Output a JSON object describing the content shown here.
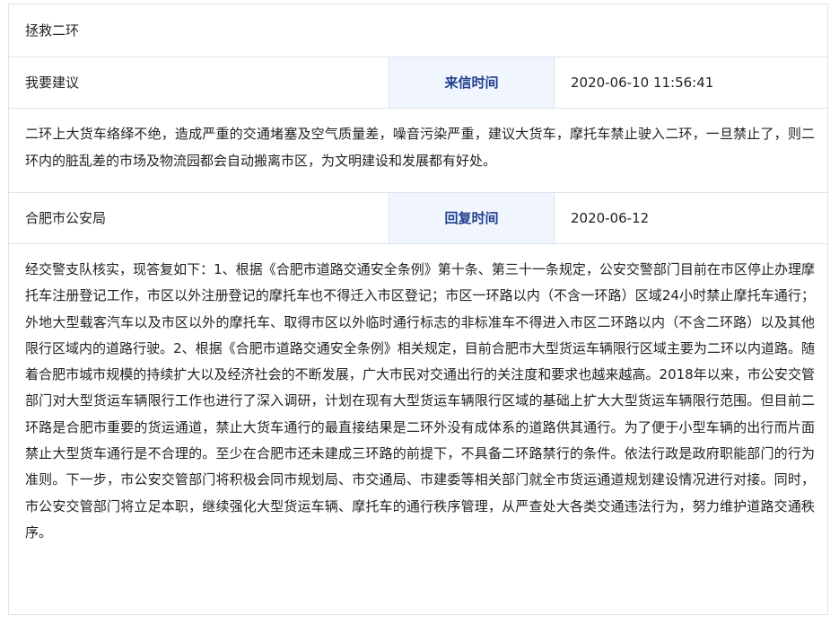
{
  "petition": {
    "title": "拯救二环",
    "type_label": "我要建议",
    "sent_time_label": "来信时间",
    "sent_time": "2020-06-10 11:56:41",
    "content": "二环上大货车络绎不绝，造成严重的交通堵塞及空气质量差，噪音污染严重，建议大货车，摩托车禁止驶入二环，一旦禁止了，则二环内的脏乱差的市场及物流园都会自动搬离市区，为文明建设和发展都有好处。"
  },
  "reply": {
    "department": "合肥市公安局",
    "reply_time_label": "回复时间",
    "reply_time": "2020-06-12",
    "content": "经交警支队核实，现答复如下：1、根据《合肥市道路交通安全条例》第十条、第三十一条规定，公安交警部门目前在市区停止办理摩托车注册登记工作，市区以外注册登记的摩托车也不得迁入市区登记；市区一环路以内（不含一环路）区域24小时禁止摩托车通行；外地大型载客汽车以及市区以外的摩托车、取得市区以外临时通行标志的非标准车不得进入市区二环路以内（不含二环路）以及其他限行区域内的道路行驶。2、根据《合肥市道路交通安全条例》相关规定，目前合肥市大型货运车辆限行区域主要为二环以内道路。随着合肥市城市规模的持续扩大以及经济社会的不断发展，广大市民对交通出行的关注度和要求也越来越高。2018年以来，市公安交管部门对大型货运车辆限行工作也进行了深入调研，计划在现有大型货运车辆限行区域的基础上扩大大型货运车辆限行范围。但目前二环路是合肥市重要的货运通道，禁止大货车通行的最直接结果是二环外没有成体系的道路供其通行。为了便于小型车辆的出行而片面禁止大型货车通行是不合理的。至少在合肥市还未建成三环路的前提下，不具备二环路禁行的条件。依法行政是政府职能部门的行为准则。下一步，市公安交管部门将积极会同市规划局、市交通局、市建委等相关部门就全市货运通道规划建设情况进行对接。同时，市公安交管部门将立足本职，继续强化大型货运车辆、摩托车的通行秩序管理，从严查处大各类交通违法行为，努力维护道路交通秩序。"
  }
}
